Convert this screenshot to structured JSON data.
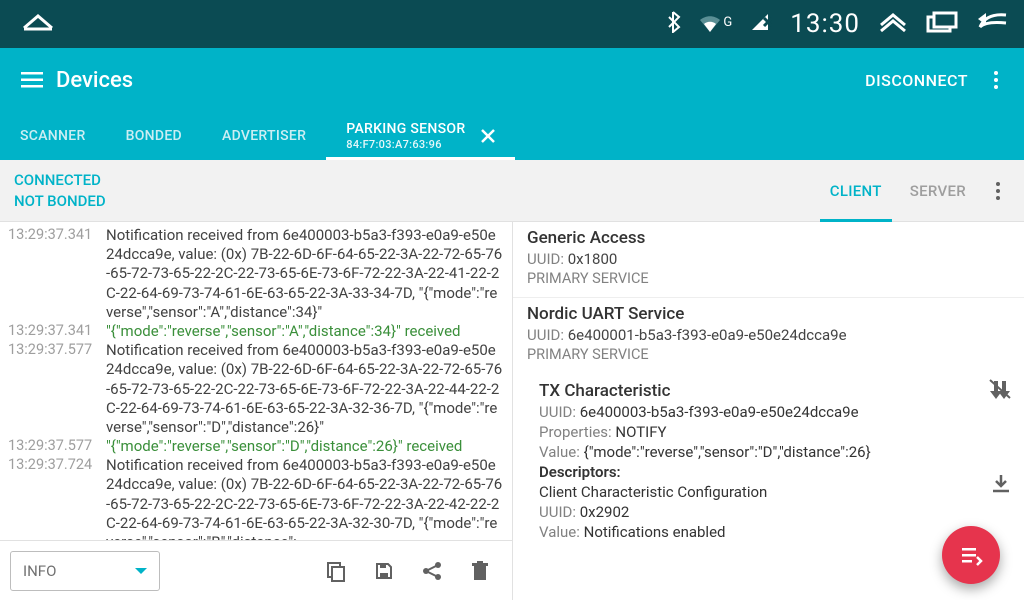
{
  "statusbar": {
    "time": "13:30",
    "network_badge": "G"
  },
  "appbar": {
    "title": "Devices",
    "disconnect": "DISCONNECT"
  },
  "tabs": [
    {
      "label": "SCANNER"
    },
    {
      "label": "BONDED"
    },
    {
      "label": "ADVERTISER"
    },
    {
      "label": "PARKING SENSOR",
      "sub": "84:F7:03:A7:63:96",
      "active": true,
      "closeable": true
    }
  ],
  "substatus": {
    "connected": "CONNECTED",
    "bonded": "NOT BONDED",
    "tabs": [
      {
        "label": "CLIENT",
        "active": true
      },
      {
        "label": "SERVER"
      }
    ]
  },
  "log": [
    {
      "ts": "13:29:37.341",
      "kind": "notif",
      "text": "Notification received from 6e400003-b5a3-f393-e0a9-e50e24dcca9e, value: (0x) 7B-22-6D-6F-64-65-22-3A-22-72-65-76-65-72-73-65-22-2C-22-73-65-6E-73-6F-72-22-3A-22-41-22-2C-22-64-69-73-74-61-6E-63-65-22-3A-33-34-7D, \"{\"mode\":\"reverse\",\"sensor\":\"A\",\"distance\":34}\""
    },
    {
      "ts": "13:29:37.341",
      "kind": "recv",
      "text": "\"{\"mode\":\"reverse\",\"sensor\":\"A\",\"distance\":34}\" received"
    },
    {
      "ts": "13:29:37.577",
      "kind": "notif",
      "text": "Notification received from 6e400003-b5a3-f393-e0a9-e50e24dcca9e, value: (0x) 7B-22-6D-6F-64-65-22-3A-22-72-65-76-65-72-73-65-22-2C-22-73-65-6E-73-6F-72-22-3A-22-44-22-2C-22-64-69-73-74-61-6E-63-65-22-3A-32-36-7D, \"{\"mode\":\"reverse\",\"sensor\":\"D\",\"distance\":26}\""
    },
    {
      "ts": "13:29:37.577",
      "kind": "recv",
      "text": "\"{\"mode\":\"reverse\",\"sensor\":\"D\",\"distance\":26}\" received"
    },
    {
      "ts": "13:29:37.724",
      "kind": "notif",
      "text": "Notification received from 6e400003-b5a3-f393-e0a9-e50e24dcca9e, value: (0x) 7B-22-6D-6F-64-65-22-3A-22-72-65-76-65-72-73-65-22-2C-22-73-65-6E-73-6F-72-22-3A-22-42-22-2C-22-64-69-73-74-61-6E-63-65-22-3A-32-30-7D, \"{\"mode\":\"reverse\",\"sensor\":\"B\",\"distance\":"
    }
  ],
  "toolbar": {
    "level": "INFO"
  },
  "services": [
    {
      "name": "Generic Access",
      "uuid_label": "UUID:",
      "uuid": "0x1800",
      "type": "PRIMARY SERVICE"
    },
    {
      "name": "Nordic UART Service",
      "uuid_label": "UUID:",
      "uuid": "6e400001-b5a3-f393-e0a9-e50e24dcca9e",
      "type": "PRIMARY SERVICE",
      "characteristic": {
        "name": "TX Characteristic",
        "uuid_label": "UUID:",
        "uuid": "6e400003-b5a3-f393-e0a9-e50e24dcca9e",
        "properties_label": "Properties:",
        "properties": "NOTIFY",
        "value_label": "Value:",
        "value": "{\"mode\":\"reverse\",\"sensor\":\"D\",\"distance\":26}",
        "descriptors_label": "Descriptors:",
        "descriptor_name": "Client Characteristic Configuration",
        "desc_uuid_label": "UUID:",
        "desc_uuid": "0x2902",
        "desc_value_label": "Value:",
        "desc_value": "Notifications enabled"
      }
    }
  ]
}
